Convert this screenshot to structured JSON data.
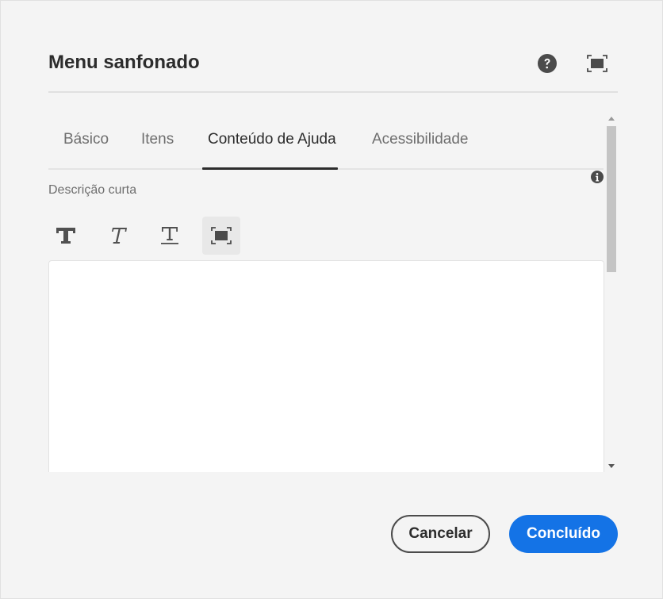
{
  "dialog": {
    "title": "Menu sanfonado",
    "help_icon": "help-circle-icon",
    "fullscreen_icon": "fullscreen-icon"
  },
  "tabs": [
    {
      "label": "Básico",
      "selected": false
    },
    {
      "label": "Itens",
      "selected": false
    },
    {
      "label": "Conteúdo de Ajuda",
      "selected": true
    },
    {
      "label": "Acessibilidade",
      "selected": false
    }
  ],
  "form": {
    "field_label": "Descrição curta",
    "info_icon": "info-icon",
    "editor_value": ""
  },
  "toolbar": {
    "buttons": [
      {
        "icon": "bold-icon"
      },
      {
        "icon": "italic-icon"
      },
      {
        "icon": "underline-icon"
      },
      {
        "icon": "fullscreen-icon"
      }
    ]
  },
  "footer": {
    "cancel_label": "Cancelar",
    "done_label": "Concluído"
  },
  "colors": {
    "accent": "#1473e6",
    "background": "#f4f4f4"
  }
}
